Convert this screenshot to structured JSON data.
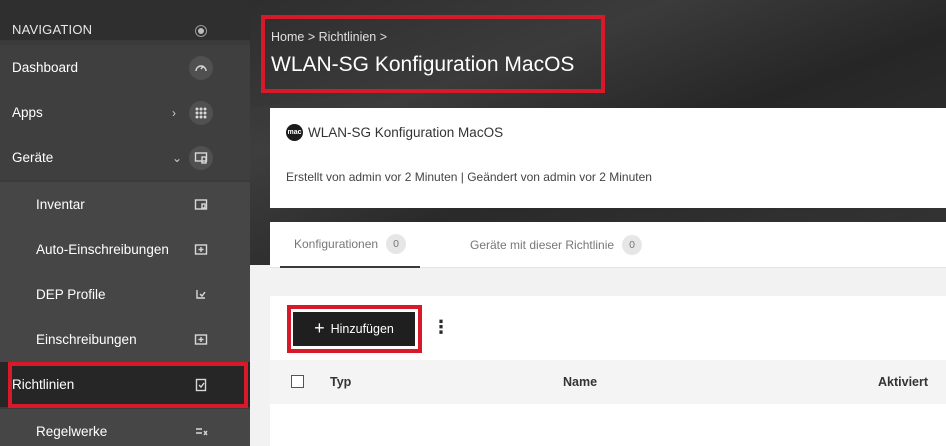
{
  "sidebar": {
    "header": "NAVIGATION",
    "items": [
      {
        "label": "Dashboard",
        "icon": "gauge-icon"
      },
      {
        "label": "Apps",
        "icon": "grid-icon",
        "has_chevron": true,
        "chevron": "›"
      },
      {
        "label": "Geräte",
        "icon": "devices-icon",
        "has_chevron": true,
        "chevron": "⌄"
      },
      {
        "label": "Inventar",
        "icon": "inventory-icon"
      },
      {
        "label": "Auto-Einschreibungen",
        "icon": "auto-enroll-icon"
      },
      {
        "label": "DEP Profile",
        "icon": "dep-profile-icon"
      },
      {
        "label": "Einschreibungen",
        "icon": "enroll-icon"
      },
      {
        "label": "Richtlinien",
        "icon": "policy-icon"
      },
      {
        "label": "Regelwerke",
        "icon": "ruleset-icon"
      }
    ]
  },
  "header": {
    "breadcrumb": "Home > Richtlinien >",
    "title": "WLAN-SG Konfiguration MacOS"
  },
  "card": {
    "badge": "mac",
    "title": "WLAN-SG Konfiguration MacOS",
    "meta": "Erstellt von admin vor 2 Minuten  |  Geändert von admin vor 2 Minuten"
  },
  "tabs": [
    {
      "label": "Konfigurationen",
      "count": "0"
    },
    {
      "label": "Geräte mit dieser Richtlinie",
      "count": "0"
    }
  ],
  "toolbar": {
    "add_label": "Hinzufügen",
    "add_icon": "+",
    "more_icon": "⋮"
  },
  "table": {
    "columns": [
      "Typ",
      "Name",
      "Aktiviert"
    ]
  },
  "colors": {
    "highlight": "#d7192a",
    "sidebar_bg": "#3a3a3a",
    "button_bg": "#1f1f1f"
  }
}
